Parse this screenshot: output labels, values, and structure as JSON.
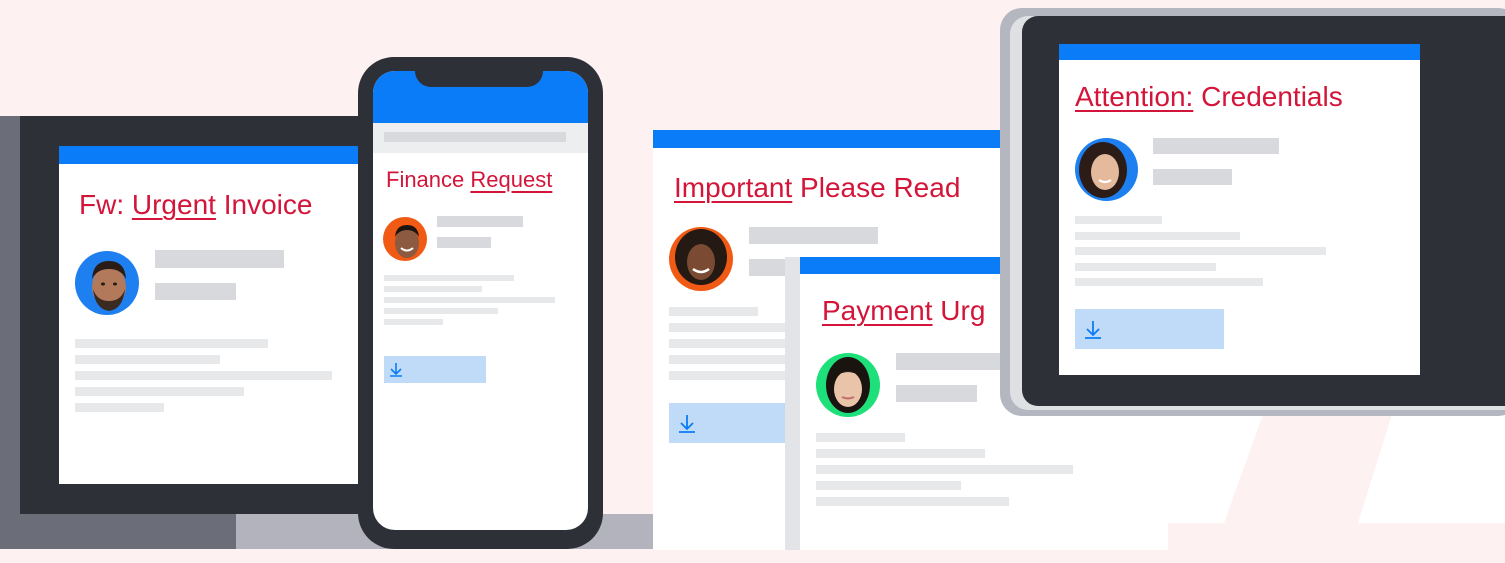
{
  "emails": {
    "laptop": {
      "title_prefix": "Fw: ",
      "title_highlight": "Urgent",
      "title_suffix": " Invoice",
      "avatar_icon": "man-beard-avatar",
      "avatar_color": "#1e7ff0"
    },
    "phone": {
      "title_prefix": "Finance ",
      "title_highlight": "Request",
      "avatar_icon": "man-smiling-avatar",
      "avatar_color": "#f05a14",
      "download_icon": "download-icon"
    },
    "important": {
      "title_highlight": "Important",
      "title_suffix": " Please Read",
      "avatar_icon": "woman-curly-hair-avatar",
      "avatar_color": "#f05a14",
      "download_icon": "download-icon"
    },
    "payment": {
      "title_highlight": "Payment",
      "title_suffix": " Urg",
      "avatar_icon": "woman-dark-hair-avatar",
      "avatar_color": "#1ee07a"
    },
    "tablet": {
      "title_highlight": "Attention:",
      "title_suffix": " Credentials",
      "avatar_icon": "woman-brunette-avatar",
      "avatar_color": "#1e7ff0",
      "download_icon": "download-icon"
    }
  },
  "colors": {
    "accent_blue": "#0a7cf7",
    "title_red": "#d4153a",
    "device_frame": "#2d3037",
    "download_fill": "#bfdbf7",
    "background": "#fdf1f2"
  }
}
